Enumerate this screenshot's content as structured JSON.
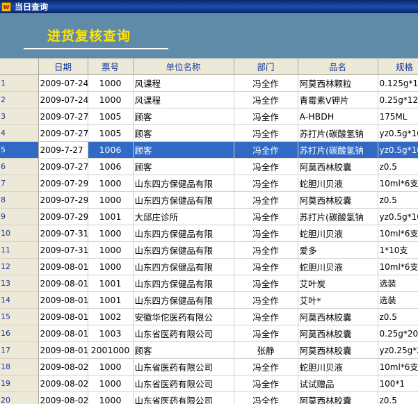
{
  "window": {
    "title": "当日查询",
    "icon_text": "W"
  },
  "page": {
    "title": "进货复核查询"
  },
  "table": {
    "columns": [
      "",
      "日期",
      "票号",
      "单位名称",
      "部门",
      "品名",
      "规格"
    ],
    "rows": [
      {
        "n": "1",
        "date": "2009-07-24",
        "no": "1000",
        "unit": "风课程",
        "dept": "冯全作",
        "product": "阿莫西林颗粒",
        "spec": "0.125g*12"
      },
      {
        "n": "2",
        "date": "2009-07-24",
        "no": "1000",
        "unit": "风课程",
        "dept": "冯全作",
        "product": "青霉素V钾片",
        "spec": "0.25g*12片"
      },
      {
        "n": "3",
        "date": "2009-07-27",
        "no": "1005",
        "unit": "顾客",
        "dept": "冯全作",
        "product": "A-HBDH",
        "spec": "175ML"
      },
      {
        "n": "4",
        "date": "2009-07-27",
        "no": "1005",
        "unit": "顾客",
        "dept": "冯全作",
        "product": "苏打片(碳酸氢钠",
        "spec": "yz0.5g*10"
      },
      {
        "n": "5",
        "date": "2009-7-27",
        "no": "1006",
        "unit": "顾客",
        "dept": "冯全作",
        "product": "苏打片(碳酸氢钠",
        "spec": "yz0.5g*10",
        "selected": true
      },
      {
        "n": "6",
        "date": "2009-07-27",
        "no": "1006",
        "unit": "顾客",
        "dept": "冯全作",
        "product": "阿莫西林胶囊",
        "spec": "z0.5"
      },
      {
        "n": "7",
        "date": "2009-07-29",
        "no": "1000",
        "unit": "山东四方保健品有限",
        "dept": "冯全作",
        "product": "蛇胆川贝液",
        "spec": "10ml*6支"
      },
      {
        "n": "8",
        "date": "2009-07-29",
        "no": "1000",
        "unit": "山东四方保健品有限",
        "dept": "冯全作",
        "product": "阿莫西林胶囊",
        "spec": "z0.5"
      },
      {
        "n": "9",
        "date": "2009-07-29",
        "no": "1001",
        "unit": "大邱庄诊所",
        "dept": "冯全作",
        "product": "苏打片(碳酸氢钠",
        "spec": "yz0.5g*10"
      },
      {
        "n": "10",
        "date": "2009-07-31",
        "no": "1000",
        "unit": "山东四方保健品有限",
        "dept": "冯全作",
        "product": "蛇胆川贝液",
        "spec": "10ml*6支"
      },
      {
        "n": "11",
        "date": "2009-07-31",
        "no": "1000",
        "unit": "山东四方保健品有限",
        "dept": "冯全作",
        "product": "爱多",
        "spec": "1*10支"
      },
      {
        "n": "12",
        "date": "2009-08-01",
        "no": "1000",
        "unit": "山东四方保健品有限",
        "dept": "冯全作",
        "product": "蛇胆川贝液",
        "spec": "10ml*6支"
      },
      {
        "n": "13",
        "date": "2009-08-01",
        "no": "1001",
        "unit": "山东四方保健品有限",
        "dept": "冯全作",
        "product": "艾叶炭",
        "spec": "选装"
      },
      {
        "n": "14",
        "date": "2009-08-01",
        "no": "1001",
        "unit": "山东四方保健品有限",
        "dept": "冯全作",
        "product": "艾叶*",
        "spec": "选装"
      },
      {
        "n": "15",
        "date": "2009-08-01",
        "no": "1002",
        "unit": "安徽华佗医药有限公",
        "dept": "冯全作",
        "product": "阿莫西林胶囊",
        "spec": "z0.5"
      },
      {
        "n": "16",
        "date": "2009-08-01",
        "no": "1003",
        "unit": "山东省医药有限公司",
        "dept": "冯全作",
        "product": "阿莫西林胶囊",
        "spec": "0.25g*20粒"
      },
      {
        "n": "17",
        "date": "2009-08-01",
        "no": "2001000",
        "unit": "顾客",
        "dept": "张静",
        "product": "阿莫西林胶囊",
        "spec": "yz0.25g*2"
      },
      {
        "n": "18",
        "date": "2009-08-02",
        "no": "1000",
        "unit": "山东省医药有限公司",
        "dept": "冯全作",
        "product": "蛇胆川贝液",
        "spec": "10ml*6支"
      },
      {
        "n": "19",
        "date": "2009-08-02",
        "no": "1000",
        "unit": "山东省医药有限公司",
        "dept": "冯全作",
        "product": "试试赠品",
        "spec": "100*1"
      },
      {
        "n": "20",
        "date": "2009-08-02",
        "no": "1000",
        "unit": "山东省医药有限公司",
        "dept": "冯全作",
        "product": "阿莫西林胶囊",
        "spec": "z0.5"
      }
    ]
  }
}
